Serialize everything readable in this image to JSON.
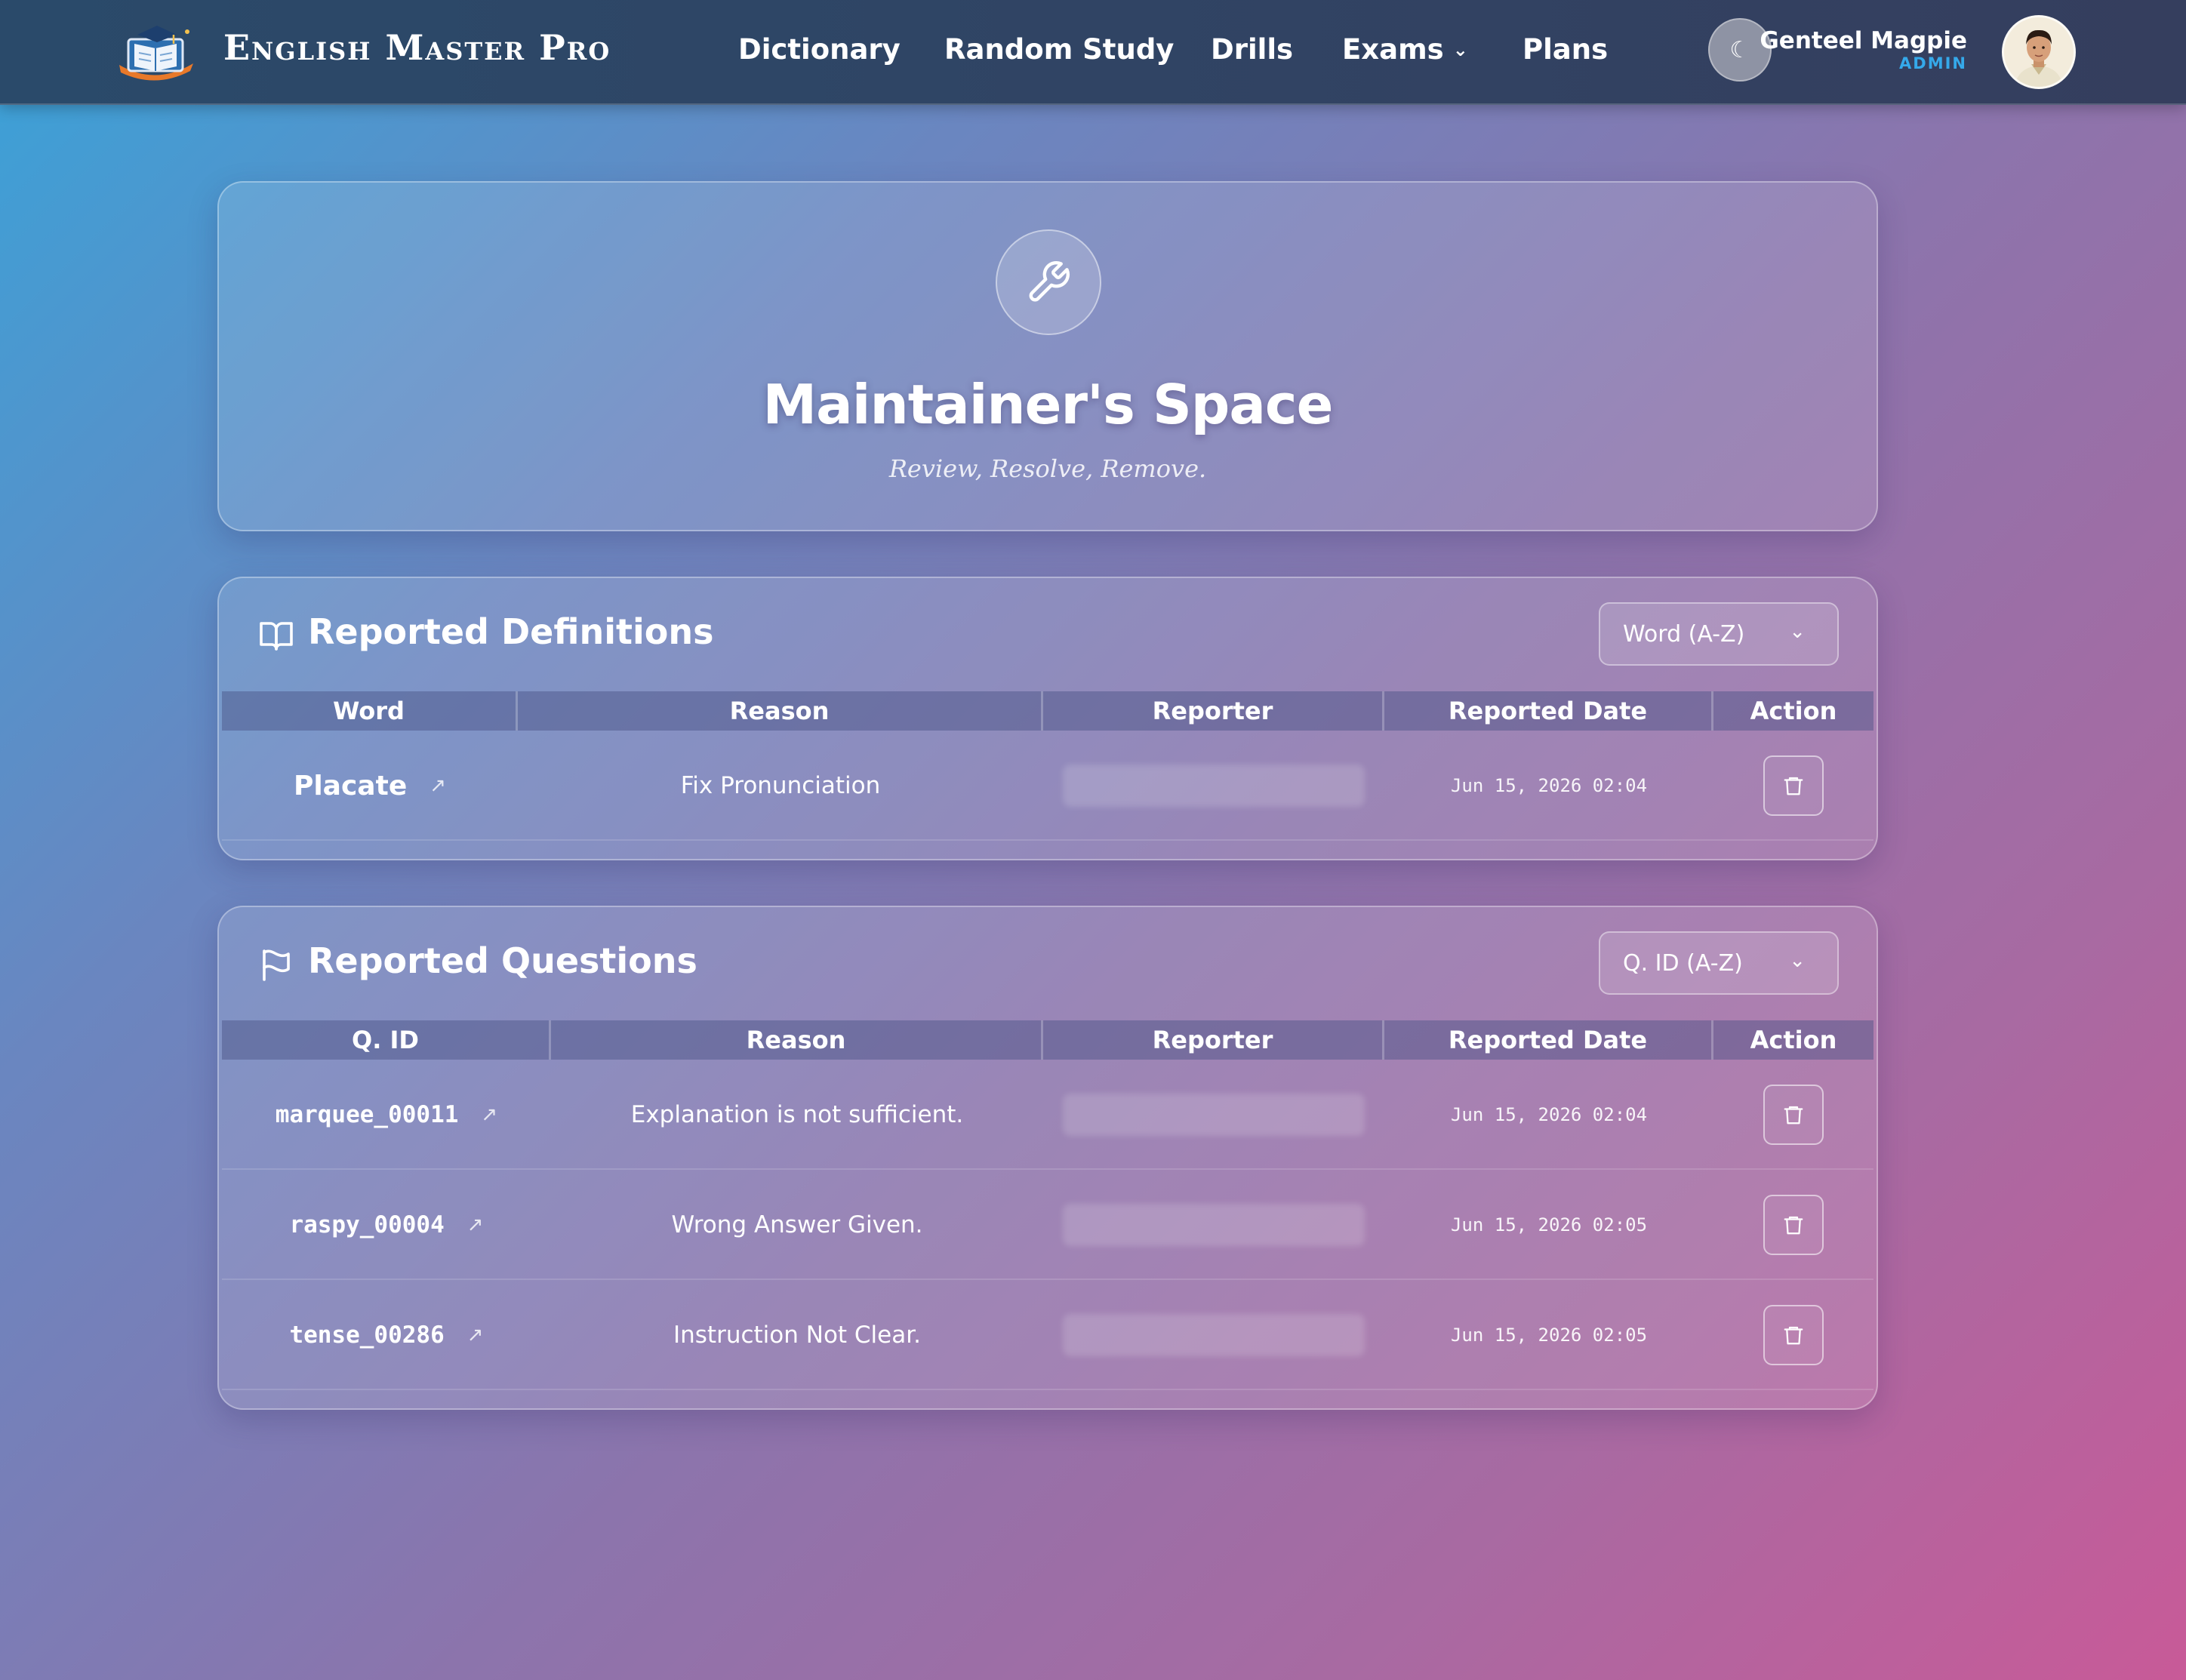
{
  "navbar": {
    "brand": "English Master Pro",
    "links": [
      {
        "label": "Dictionary"
      },
      {
        "label": "Random Study"
      },
      {
        "label": "Drills"
      },
      {
        "label": "Exams",
        "has_dropdown": true
      },
      {
        "label": "Plans"
      }
    ],
    "theme_toggle_icon": "☾",
    "user": {
      "name": "Genteel Magpie",
      "role": "ADMIN"
    }
  },
  "hero": {
    "icon": "wrench-icon",
    "title": "Maintainer's Space",
    "subtitle": "Review, Resolve, Remove."
  },
  "definitions": {
    "icon": "book-icon",
    "title": "Reported Definitions",
    "sort": {
      "selected": "Word (A-Z)"
    },
    "columns": [
      "Word",
      "Reason",
      "Reporter",
      "Reported Date",
      "Action"
    ],
    "rows": [
      {
        "word": "Placate",
        "reason": "Fix Pronunciation",
        "reporter": "",
        "date": "Jun 15, 2026 02:04"
      }
    ]
  },
  "questions": {
    "icon": "flag-icon",
    "title": "Reported Questions",
    "sort": {
      "selected": "Q. ID (A-Z)"
    },
    "columns": [
      "Q. ID",
      "Reason",
      "Reporter",
      "Reported Date",
      "Action"
    ],
    "rows": [
      {
        "qid": "marquee_00011",
        "reason": "Explanation is not sufficient.",
        "reporter": "",
        "date": "Jun 15, 2026 02:04"
      },
      {
        "qid": "raspy_00004",
        "reason": "Wrong Answer Given.",
        "reporter": "",
        "date": "Jun 15, 2026 02:05"
      },
      {
        "qid": "tense_00286",
        "reason": "Instruction Not Clear.",
        "reporter": "",
        "date": "Jun 15, 2026 02:05"
      }
    ]
  },
  "colors": {
    "accent_role": "#35a9ea",
    "navbar": "#304464"
  }
}
